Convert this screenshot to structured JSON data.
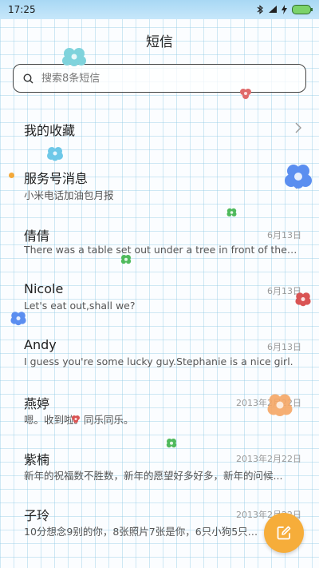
{
  "status_bar": {
    "time": "17:25",
    "icons": [
      "bluetooth-icon",
      "wifi-icon",
      "charging-icon",
      "battery-icon"
    ]
  },
  "app": {
    "title": "短信"
  },
  "search": {
    "placeholder": "搜索8条短信"
  },
  "favorites": {
    "label": "我的收藏"
  },
  "conversations": [
    {
      "name": "服务号消息",
      "preview": "小米电话加油包月报",
      "date": "",
      "unread": true
    },
    {
      "name": "倩倩",
      "preview": "There was a table set out under a tree in front of the ho...",
      "date": "6月13日",
      "unread": false
    },
    {
      "name": "Nicole",
      "preview": "Let's eat out,shall we?",
      "date": "6月13日",
      "unread": false
    },
    {
      "name": "Andy",
      "preview": "I guess you're some lucky guy.Stephanie is a nice girl.",
      "date": "6月13日",
      "unread": false
    },
    {
      "name": "燕婷",
      "preview": "嗯。收到啦。同乐同乐。",
      "date": "2013年2月22日",
      "unread": false
    },
    {
      "name": "紫楠",
      "preview": "新年的祝福数不胜数，新年的愿望好多好多，新年的问候...",
      "date": "2013年2月22日",
      "unread": false
    },
    {
      "name": "子玲",
      "preview": "10分想念9别的你，8张照片7张是你，6只小狗5只像你...",
      "date": "2013年2月22日",
      "unread": false
    }
  ],
  "compose": {
    "icon": "compose-icon"
  },
  "colors": {
    "accent": "#f6ad3a",
    "unread_dot": "#f4a93a",
    "grid": "#96cde6"
  }
}
